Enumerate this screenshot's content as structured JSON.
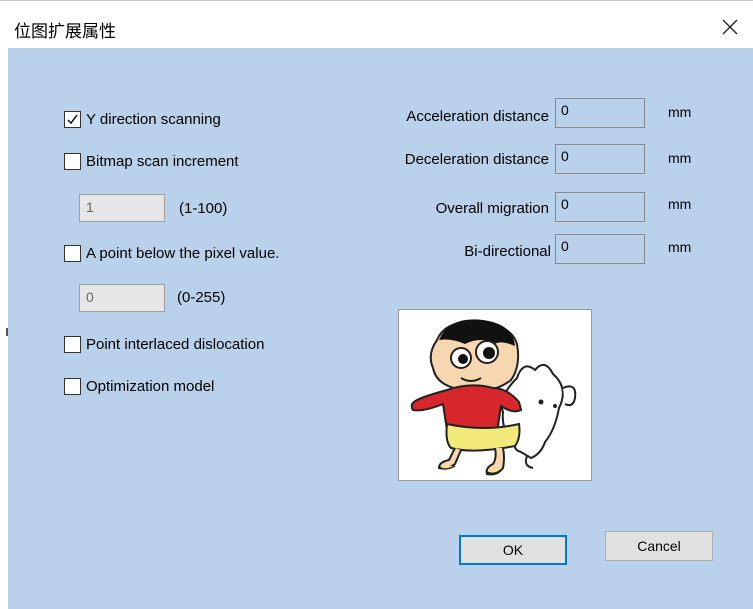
{
  "window": {
    "title": "位图扩展属性"
  },
  "left": {
    "options": [
      {
        "label": "Y direction scanning",
        "checked": true
      },
      {
        "label": "Bitmap scan increment",
        "checked": false
      },
      {
        "label": "A point below the pixel value.",
        "checked": false
      },
      {
        "label": "Point interlaced dislocation",
        "checked": false
      },
      {
        "label": "Optimization model",
        "checked": false
      }
    ],
    "increment": {
      "value": "1",
      "range": "(1-100)"
    },
    "pixel_value": {
      "value": "0",
      "range": "(0-255)"
    }
  },
  "right": {
    "fields": [
      {
        "label": "Acceleration distance",
        "value": "0",
        "unit": "mm"
      },
      {
        "label": "Deceleration distance",
        "value": "0",
        "unit": "mm"
      },
      {
        "label": "Overall migration",
        "value": "0",
        "unit": "mm"
      },
      {
        "label": "Bi-directional",
        "value": "0",
        "unit": "mm"
      }
    ]
  },
  "buttons": {
    "ok": "OK",
    "cancel": "Cancel"
  },
  "colors": {
    "client_bg": "#b9d1eb",
    "default_button_border": "#0078d7"
  },
  "icons": {
    "close": "close-icon",
    "check": "checkmark-icon"
  }
}
